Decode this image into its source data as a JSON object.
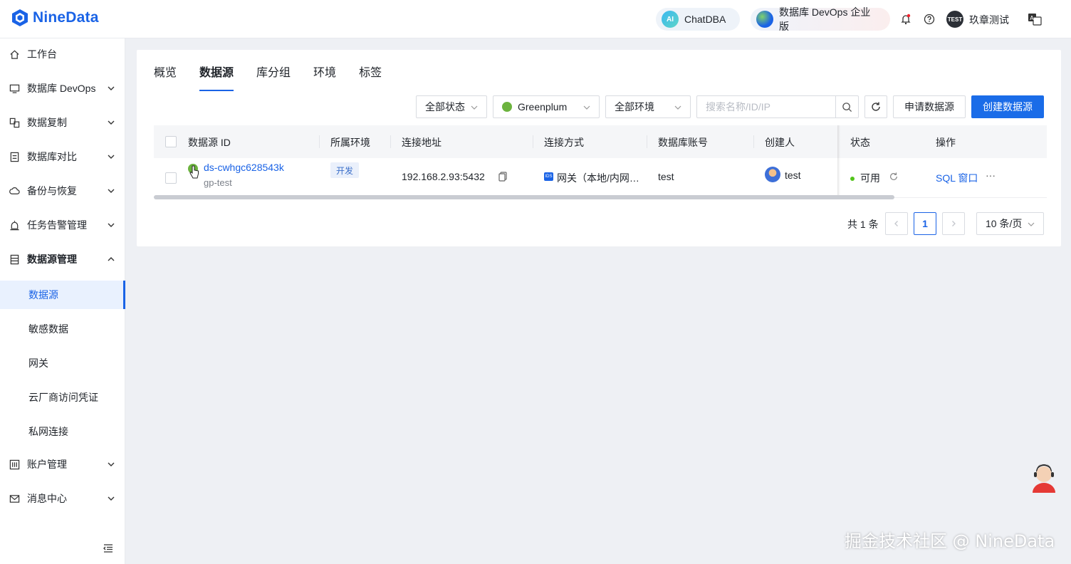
{
  "brand": {
    "name": "NineData"
  },
  "topbar": {
    "chatdba_label": "ChatDBA",
    "chatdba_badge": "AI",
    "devops_label": "数据库 DevOps 企业版",
    "avatar_text": "TEST",
    "user_name": "玖章测试"
  },
  "sidebar": {
    "items": [
      {
        "label": "工作台",
        "icon": "home-icon"
      },
      {
        "label": "数据库 DevOps",
        "icon": "monitor-icon"
      },
      {
        "label": "数据复制",
        "icon": "replicate-icon"
      },
      {
        "label": "数据库对比",
        "icon": "compare-icon"
      },
      {
        "label": "备份与恢复",
        "icon": "backup-icon"
      },
      {
        "label": "任务告警管理",
        "icon": "alarm-icon"
      },
      {
        "label": "数据源管理",
        "icon": "datasource-icon"
      },
      {
        "label": "账户管理",
        "icon": "account-icon"
      },
      {
        "label": "消息中心",
        "icon": "mail-icon"
      }
    ],
    "sub_items": [
      "数据源",
      "敏感数据",
      "网关",
      "云厂商访问凭证",
      "私网连接"
    ]
  },
  "tabs": [
    "概览",
    "数据源",
    "库分组",
    "环境",
    "标签"
  ],
  "filters": {
    "status": "全部状态",
    "db_type": "Greenplum",
    "env": "全部环境",
    "search_placeholder": "搜索名称/ID/IP",
    "apply_button": "申请数据源",
    "create_button": "创建数据源"
  },
  "table": {
    "columns": [
      "数据源 ID",
      "所属环境",
      "连接地址",
      "连接方式",
      "数据库账号",
      "创建人",
      "状态",
      "操作"
    ],
    "rows": [
      {
        "id": "ds-cwhgc628543k",
        "name": "gp-test",
        "env": "开发",
        "address": "192.168.2.93:5432",
        "conn_badge": "IDS",
        "conn_method": "网关（本地/内网…",
        "account": "test",
        "creator": "test",
        "status": "可用",
        "action_sql": "SQL 窗口",
        "action_more": "···"
      }
    ]
  },
  "pagination": {
    "total": "共 1 条",
    "current_page": "1",
    "page_size": "10 条/页"
  },
  "watermark": "掘金技术社区 @ NineData",
  "colors": {
    "primary": "#1a63e6",
    "success": "#52c41a",
    "greenplum": "#6cb33e"
  }
}
